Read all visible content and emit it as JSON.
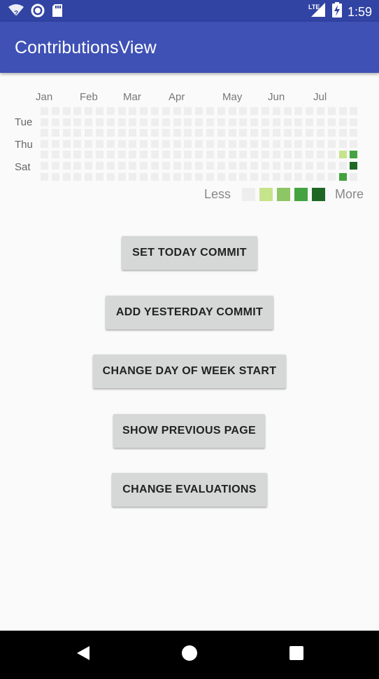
{
  "status_bar": {
    "time": "1:59",
    "network_label": "LTE",
    "icons": [
      "wifi-question-icon",
      "circle-icon",
      "sd-card-icon",
      "lte-signal-icon",
      "battery-charging-icon"
    ]
  },
  "app_bar": {
    "title": "ContributionsView"
  },
  "contributions": {
    "months": [
      "Jan",
      "Feb",
      "Mar",
      "Apr",
      "May",
      "Jun",
      "Jul"
    ],
    "day_labels": [
      "Tue",
      "Thu",
      "Sat"
    ],
    "legend": {
      "less": "Less",
      "more": "More",
      "colors": [
        "#eeeeee",
        "#c6e48b",
        "#8cc665",
        "#44a340",
        "#1e6823"
      ]
    },
    "active_cells": [
      {
        "week": 27,
        "day": 4,
        "level": 1
      },
      {
        "week": 28,
        "day": 4,
        "level": 3
      },
      {
        "week": 28,
        "day": 5,
        "level": 4
      },
      {
        "week": 27,
        "day": 6,
        "level": 3
      }
    ],
    "weeks": 29,
    "days": 7
  },
  "buttons": {
    "set_today": "SET TODAY COMMIT",
    "add_yesterday": "ADD YESTERDAY COMMIT",
    "change_day_of_week": "CHANGE DAY OF WEEK START",
    "show_previous": "SHOW PREVIOUS PAGE",
    "change_evaluations": "CHANGE EVALUATIONS"
  },
  "nav_bar": {
    "icons": [
      "back-icon",
      "home-icon",
      "recents-icon"
    ]
  }
}
